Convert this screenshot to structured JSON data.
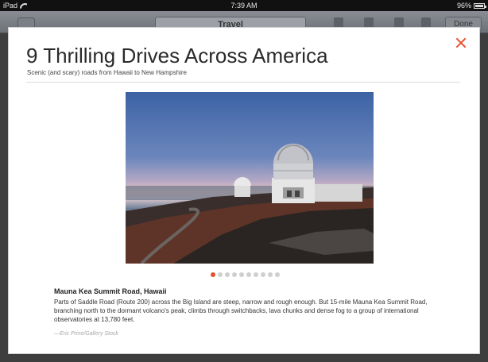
{
  "status_bar": {
    "device": "iPad",
    "time": "7:39 AM",
    "battery": "96%",
    "battery_level": 0.96
  },
  "toolbar": {
    "section_label": "Travel",
    "done_label": "Done"
  },
  "article": {
    "title": "9 Thrilling Drives Across America",
    "subtitle": "Scenic (and scary) roads from Hawaii to New Hampshire"
  },
  "gallery": {
    "total_slides": 10,
    "current_slide": 1
  },
  "caption": {
    "heading": "Mauna Kea Summit Road, Hawaii",
    "body": "Parts of Saddle Road (Route 200) across the Big Island are steep, narrow and rough enough. But 15-mile Mauna Kea Summit Road, branching north to the dormant volcano's peak, climbs through switchbacks, lava chunks and dense fog to a group of international observatories at 13,780 feet.",
    "credit": "—Eric Prine/Gallery Stock"
  },
  "icons": {
    "close": "close-icon",
    "wifi": "wifi-icon",
    "battery": "battery-icon",
    "back": "back-icon"
  },
  "colors": {
    "accent": "#e8502e",
    "dot_inactive": "#cfcfcf",
    "title_text": "#2a2a2a"
  }
}
